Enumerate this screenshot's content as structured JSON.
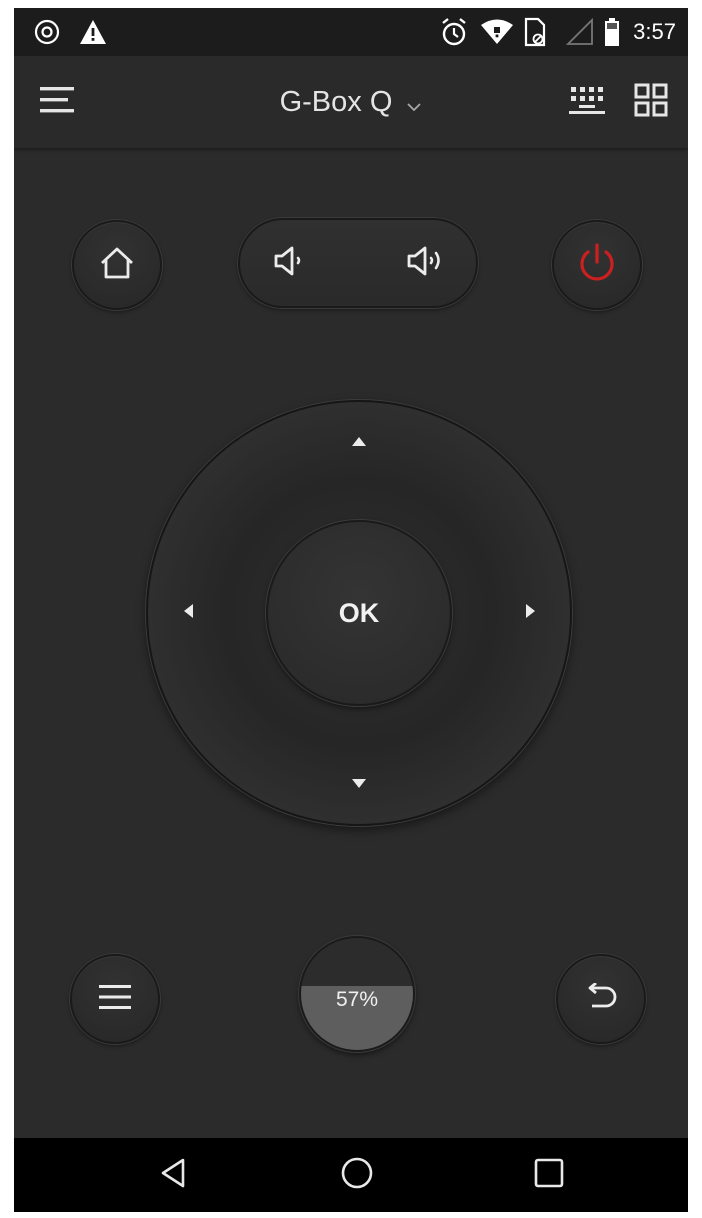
{
  "status_bar": {
    "time": "3:57",
    "left_icons": [
      "at-sign-icon",
      "warning-icon"
    ],
    "right_icons": [
      "alarm-icon",
      "wifi-icon",
      "sim-card-icon",
      "signal-icon",
      "battery-icon"
    ]
  },
  "app_bar": {
    "device_name": "G-Box Q",
    "icons": [
      "hamburger-menu-icon",
      "chevron-down-icon",
      "keyboard-icon",
      "grid-apps-icon"
    ]
  },
  "remote": {
    "top_row_icons": [
      "home-icon",
      "volume-down-icon",
      "volume-up-icon",
      "power-icon"
    ],
    "dpad": {
      "ok_label": "OK",
      "arrow_icons": [
        "arrow-up-icon",
        "arrow-left-icon",
        "arrow-right-icon",
        "arrow-down-icon"
      ]
    },
    "bottom_row_icons": [
      "menu-icon",
      "back-icon"
    ],
    "battery": {
      "label": "57%",
      "level": 0.57
    }
  },
  "colors": {
    "background": "#2b2b2b",
    "power_accent": "#cc1f1f",
    "text": "#f0f0f0"
  },
  "nav_bar": {
    "icons": [
      "nav-back-icon",
      "nav-home-icon",
      "nav-recents-icon"
    ]
  }
}
